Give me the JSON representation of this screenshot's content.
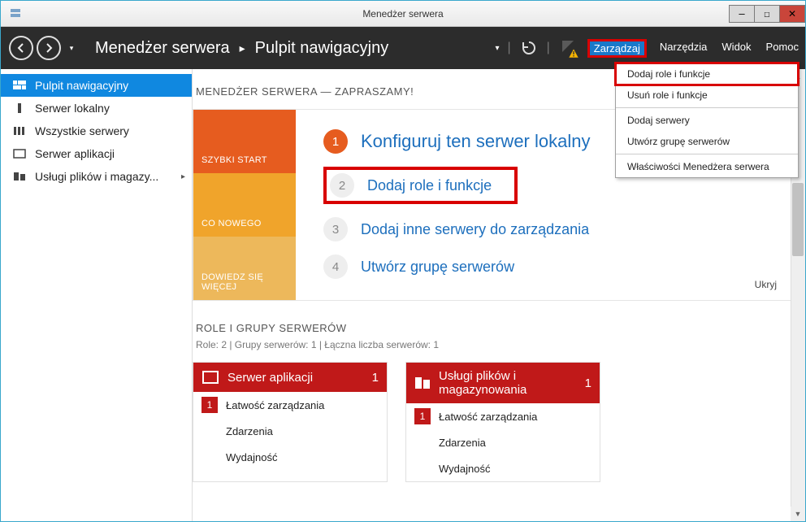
{
  "window": {
    "title": "Menedżer serwera"
  },
  "win_controls": {
    "min": "—",
    "max": "☐",
    "close": "✕"
  },
  "header": {
    "app_name": "Menedżer serwera",
    "page": "Pulpit nawigacyjny",
    "menu": {
      "manage": "Zarządzaj",
      "tools": "Narzędzia",
      "view": "Widok",
      "help": "Pomoc"
    }
  },
  "dropdown": {
    "add_roles": "Dodaj role i funkcje",
    "remove_roles": "Usuń role i funkcje",
    "add_servers": "Dodaj serwery",
    "create_group": "Utwórz grupę serwerów",
    "properties": "Właściwości Menedżera serwera"
  },
  "sidebar": {
    "dashboard": "Pulpit nawigacyjny",
    "local_server": "Serwer lokalny",
    "all_servers": "Wszystkie serwery",
    "app_server": "Serwer aplikacji",
    "file_services": "Usługi plików i magazy..."
  },
  "welcome": {
    "title": "MENEDŻER SERWERA — ZAPRASZAMY!",
    "tiles": {
      "quick": "SZYBKI START",
      "new": "CO NOWEGO",
      "learn": "DOWIEDZ SIĘ WIĘCEJ"
    },
    "step1": "Konfiguruj ten serwer lokalny",
    "step2": "Dodaj role i funkcje",
    "step3": "Dodaj inne serwery do zarządzania",
    "step4": "Utwórz grupę serwerów",
    "hide": "Ukryj"
  },
  "roles": {
    "title": "ROLE I GRUPY SERWERÓW",
    "subtitle": "Role: 2 | Grupy serwerów: 1 | Łączna liczba serwerów: 1",
    "card1": {
      "name": "Serwer aplikacji",
      "count": "1"
    },
    "card2": {
      "name": "Usługi plików i magazynowania",
      "count": "1"
    },
    "rows": {
      "manage": "Łatwość zarządzania",
      "events": "Zdarzenia",
      "perf": "Wydajność"
    },
    "badge": "1"
  }
}
